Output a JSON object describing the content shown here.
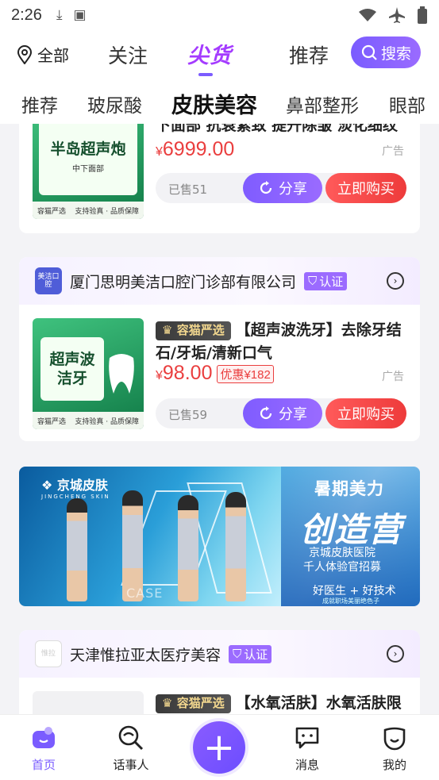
{
  "status_bar": {
    "time": "2:26"
  },
  "top_nav": {
    "location": "全部",
    "tabs": [
      "关注",
      "尖货",
      "推荐"
    ],
    "search_label": "搜索"
  },
  "categories": [
    "推荐",
    "玻尿酸",
    "皮肤美容",
    "鼻部整形",
    "眼部"
  ],
  "active_category": "皮肤美容",
  "feed": {
    "card1": {
      "image_title": "半岛超声炮",
      "image_subtitle": "中下面部",
      "image_footer_left": "容猫严选",
      "image_footer_right": "支持验真 · 品质保障",
      "title_line": "下面部 抗衰紧致 提升除皱 淡化细纹",
      "price_symbol": "¥",
      "price": "6999.00",
      "ad": "广告",
      "sold": "已售51",
      "share": "分享",
      "buy": "立即购买"
    },
    "card2": {
      "store": "厦门思明美洁口腔门诊部有限公司",
      "store_logo_text": "美洁口腔",
      "verify": "认证",
      "image_title": "超声波洁牙",
      "image_footer_left": "容猫严选",
      "image_footer_right": "支持验真 · 品质保障",
      "badge": "容猫严选",
      "title": "【超声波洗牙】去除牙结石/牙垢/清新口气",
      "price_symbol": "¥",
      "price": "98.00",
      "coupon": "优惠¥182",
      "ad": "广告",
      "sold": "已售59",
      "share": "分享",
      "buy": "立即购买"
    },
    "banner": {
      "brand": "京城皮肤",
      "brand_en": "JINGCHENG SKIN",
      "headline1": "暑期美力",
      "headline2": "创造营",
      "sub1": "京城皮肤医院",
      "sub2": "千人体验官招募",
      "sub3": "好医生 + 好技术",
      "sub4": "成就职场美丽绝色子",
      "case_text": "CASE"
    },
    "card3": {
      "store": "天津惟拉亚太医疗美容",
      "store_logo_text": "惟拉",
      "verify": "认证",
      "badge": "容猫严选",
      "title": "【水氧活肤】水氧活肤限"
    }
  },
  "tabbar": [
    "首页",
    "话事人",
    "消息",
    "我的"
  ],
  "colors": {
    "accent": "#7a5cff",
    "price": "#ea3e3e",
    "buy": "#ee3b3b"
  }
}
